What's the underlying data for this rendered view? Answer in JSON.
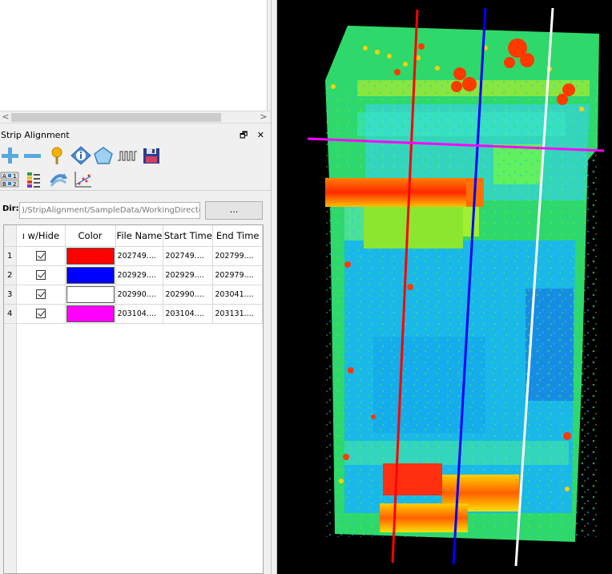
{
  "panel": {
    "title": "Strip Alignment",
    "float_close_buttons": "🗗 ✕"
  },
  "scrollbar": {
    "left_arrow": "<",
    "right_arrow": ">"
  },
  "toolbar_row1": [
    "add-icon",
    "remove-icon",
    "pin-icon",
    "info-icon",
    "polygon-icon",
    "waveform-icon",
    "save-icon"
  ],
  "toolbar_row2": [
    "ab-compare-icon",
    "color-bars-icon",
    "align-arrows-icon",
    "scatter-axis-icon"
  ],
  "dir": {
    "label": "Dir:",
    "value": ")/StripAlignment/SampleData/WorkingDirectory/",
    "browse_label": "..."
  },
  "table": {
    "headers": [
      "Show/Hide",
      "Color",
      "File Name",
      "Start Time",
      "End Time"
    ],
    "header_display": [
      "ı w/Hide",
      "Color",
      "File Name",
      "Start Time",
      "End Time"
    ],
    "rows": [
      {
        "num": "1",
        "checked": true,
        "color": "#ff0000",
        "file": "202749....",
        "start": "202749....",
        "end": "202799...."
      },
      {
        "num": "2",
        "checked": true,
        "color": "#0000ff",
        "file": "202929....",
        "start": "202929....",
        "end": "202979...."
      },
      {
        "num": "3",
        "checked": true,
        "color": "#ffffff",
        "file": "202990....",
        "start": "202990....",
        "end": "203041...."
      },
      {
        "num": "4",
        "checked": true,
        "color": "#ff00ff",
        "file": "203104....",
        "start": "203104....",
        "end": "203131...."
      }
    ]
  },
  "viewport": {
    "background": "#000000",
    "strip_colors": [
      "#ff0000",
      "#0000ff",
      "#ffffff",
      "#ff00ff"
    ]
  }
}
